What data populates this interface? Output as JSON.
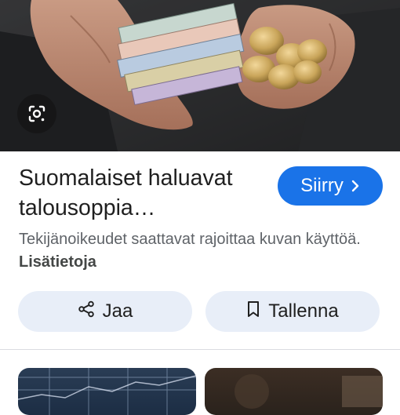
{
  "result": {
    "title": "Suomalaiset haluavat talousoppia…",
    "visit_label": "Siirry",
    "notice_text": "Tekijänoikeudet saattavat rajoittaa kuvan käyttöä.",
    "notice_link": "Lisätietoja"
  },
  "actions": {
    "share_label": "Jaa",
    "save_label": "Tallenna"
  },
  "icons": {
    "lens": "google-lens-icon",
    "visit": "chevron-right-icon",
    "share": "share-icon",
    "save": "bookmark-icon"
  },
  "colors": {
    "accent": "#1a73e8",
    "button_bg": "#e8eef8",
    "text": "#1f1f1f",
    "muted": "#5f6368"
  }
}
